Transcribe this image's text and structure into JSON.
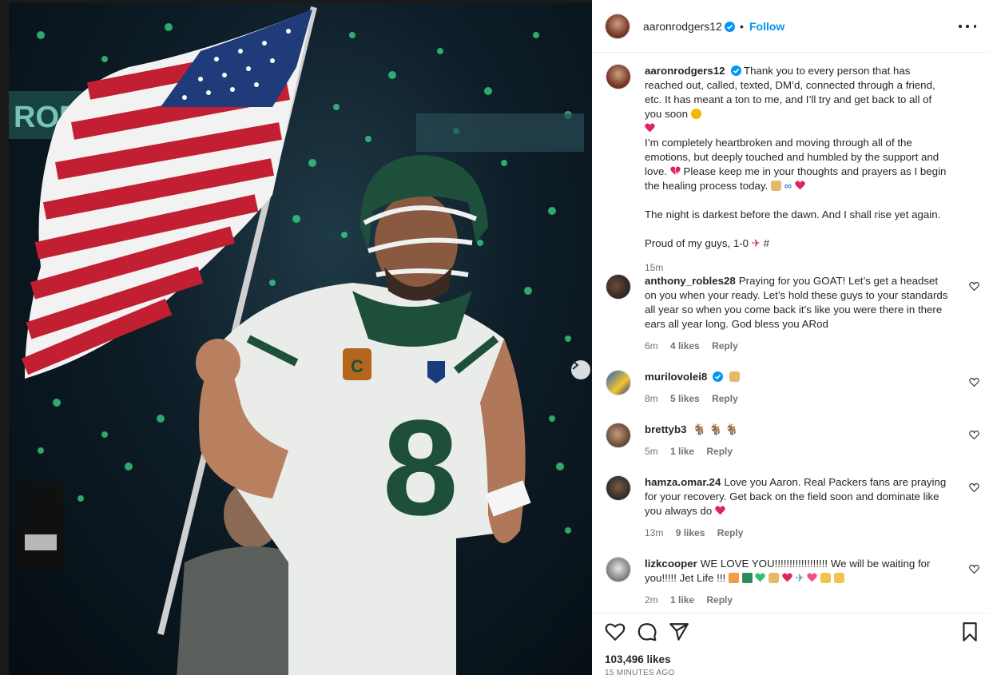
{
  "post": {
    "author": "aaronrodgers12",
    "follow_label": "Follow",
    "separator": "•",
    "caption": {
      "p1": "Thank you to every person that has reached out, called, texted, DM’d, connected through a friend, etc. It has meant a ton to me, and I’ll try and get back to all of you soon",
      "p2a": "I’m completely heartbroken and moving through all of the emotions, but deeply touched and humbled by the support and love.",
      "p2b": "Please keep me in your thoughts and prayers as I begin the healing process today.",
      "p3": "The night is darkest before the dawn. And I shall rise yet again.",
      "p4": "Proud of my guys, 1-0",
      "p4_end": "#",
      "time": "15m"
    },
    "likes": "103,496 likes",
    "time_ago": "15 MINUTES AGO"
  },
  "photo": {
    "jersey_number": "8",
    "captain_patch": "C"
  },
  "comments": [
    {
      "user": "anthony_robles28",
      "text": "Praying for you GOAT! Let’s get a headset on you when your ready. Let’s hold these guys to your standards all year so when you come back it’s like you were there in there ears all year long. God bless you ARod",
      "time": "6m",
      "likes": "4 likes",
      "reply": "Reply"
    },
    {
      "user": "murilovolei8",
      "text": "",
      "time": "8m",
      "likes": "5 likes",
      "reply": "Reply"
    },
    {
      "user": "brettyb3",
      "text": "",
      "time": "5m",
      "likes": "1 like",
      "reply": "Reply"
    },
    {
      "user": "hamza.omar.24",
      "text": "Love you Aaron. Real Packers fans are praying for your recovery. Get back on the field soon and dominate like you always do",
      "time": "13m",
      "likes": "9 likes",
      "reply": "Reply"
    },
    {
      "user": "lizkcooper",
      "text": "WE LOVE YOU!!!!!!!!!!!!!!!!!! We will be waiting for you!!!!! Jet Life !!!",
      "time": "2m",
      "likes": "1 like",
      "reply": "Reply"
    }
  ],
  "colors": {
    "accent": "#0095f6",
    "verified": "#0095f6",
    "heart": "#e0245e",
    "jets_green": "#1d4f3a"
  }
}
